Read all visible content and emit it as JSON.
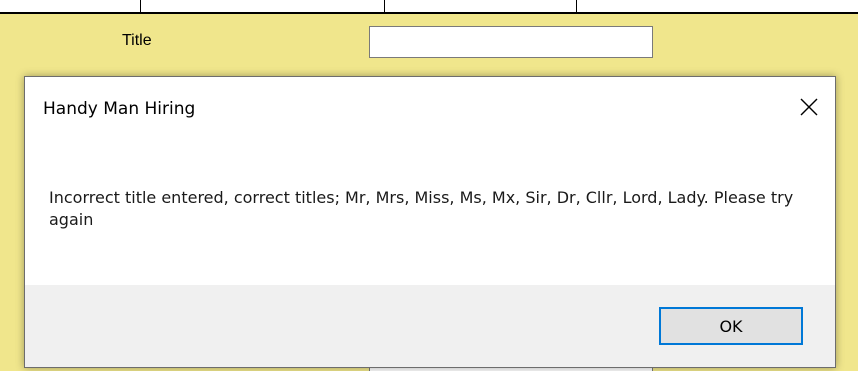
{
  "background_color": "#f0e68c",
  "form": {
    "title_label": "Title",
    "title_value": ""
  },
  "dialog": {
    "title": "Handy Man Hiring",
    "message": "Incorrect title entered, correct titles; Mr, Mrs, Miss, Ms, Mx, Sir, Dr, Cllr, Lord, Lady. Please try again",
    "ok_label": "OK",
    "close_icon": "close-icon",
    "accent_color": "#0078d7"
  }
}
